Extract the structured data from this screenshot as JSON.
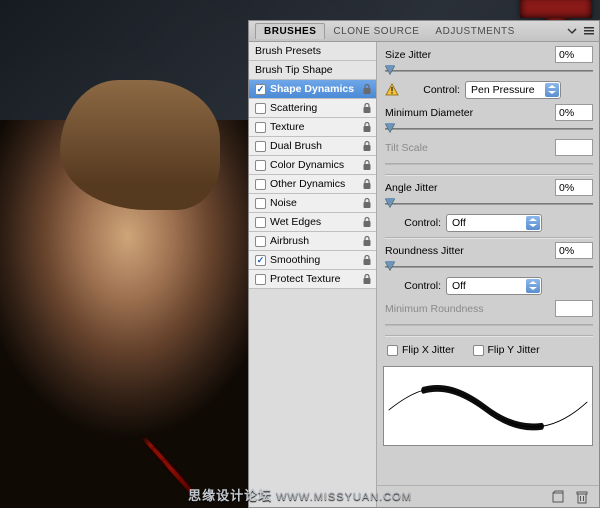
{
  "tabs": {
    "active": "BRUSHES",
    "others": [
      "CLONE SOURCE",
      "ADJUSTMENTS"
    ]
  },
  "left": {
    "presets": "Brush Presets",
    "tip": "Brush Tip Shape",
    "items": [
      {
        "label": "Shape Dynamics",
        "checked": true,
        "selected": true
      },
      {
        "label": "Scattering",
        "checked": false,
        "selected": false
      },
      {
        "label": "Texture",
        "checked": false,
        "selected": false
      },
      {
        "label": "Dual Brush",
        "checked": false,
        "selected": false
      },
      {
        "label": "Color Dynamics",
        "checked": false,
        "selected": false
      },
      {
        "label": "Other Dynamics",
        "checked": false,
        "selected": false
      },
      {
        "label": "Noise",
        "checked": false,
        "selected": false
      },
      {
        "label": "Wet Edges",
        "checked": false,
        "selected": false
      },
      {
        "label": "Airbrush",
        "checked": false,
        "selected": false
      },
      {
        "label": "Smoothing",
        "checked": true,
        "selected": false
      },
      {
        "label": "Protect Texture",
        "checked": false,
        "selected": false
      }
    ]
  },
  "settings": {
    "size_jitter": {
      "label": "Size Jitter",
      "value": "0%",
      "thumb_pct": 0
    },
    "size_control": {
      "label": "Control:",
      "value": "Pen Pressure",
      "warn": true
    },
    "min_diameter": {
      "label": "Minimum Diameter",
      "value": "0%",
      "thumb_pct": 0
    },
    "tilt_scale": {
      "label": "Tilt Scale",
      "disabled": true
    },
    "angle_jitter": {
      "label": "Angle Jitter",
      "value": "0%",
      "thumb_pct": 0
    },
    "angle_control": {
      "label": "Control:",
      "value": "Off"
    },
    "round_jitter": {
      "label": "Roundness Jitter",
      "value": "0%",
      "thumb_pct": 0
    },
    "round_control": {
      "label": "Control:",
      "value": "Off"
    },
    "min_round": {
      "label": "Minimum Roundness",
      "disabled": true
    },
    "flip_x": {
      "label": "Flip X Jitter",
      "checked": false
    },
    "flip_y": {
      "label": "Flip Y Jitter",
      "checked": false
    }
  },
  "watermark": {
    "main": "思缘设计论坛",
    "url": "WWW.MISSYUAN.COM"
  }
}
